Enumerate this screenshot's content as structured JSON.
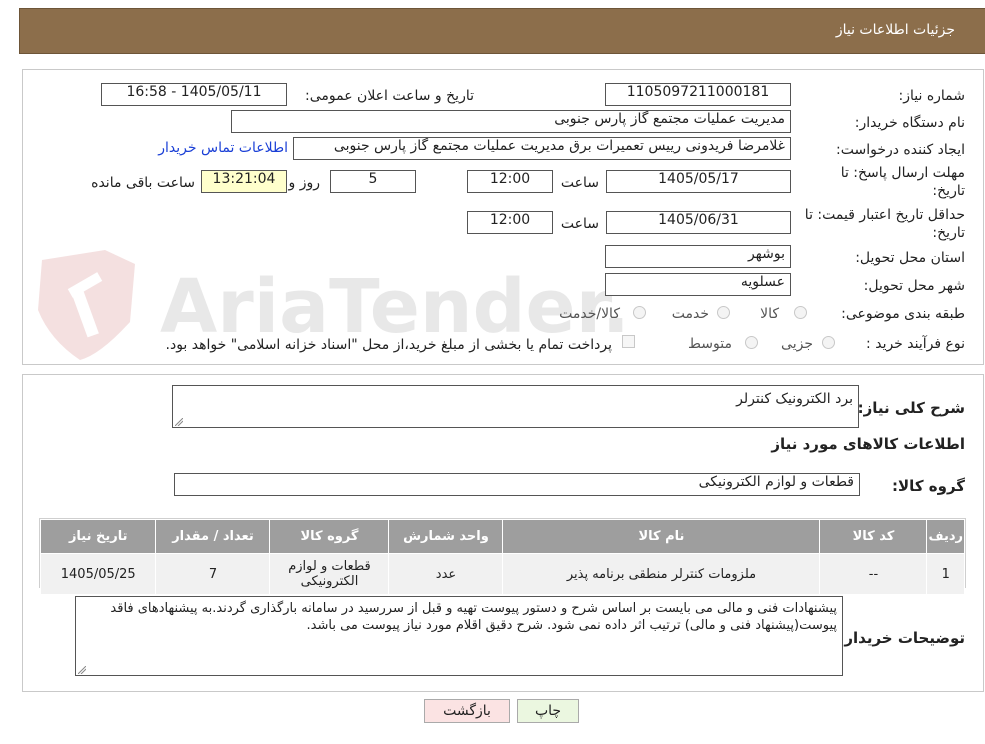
{
  "header": {
    "title": "جزئیات اطلاعات نیاز"
  },
  "watermark": {
    "text": "AriaTender.neT"
  },
  "form": {
    "need_number_label": "شماره نیاز:",
    "need_number": "1105097211000181",
    "announce_label": "تاریخ و ساعت اعلان عمومی:",
    "announce_value": "1405/05/11 - 16:58",
    "buyer_org_label": "نام دستگاه خریدار:",
    "buyer_org": "مدیریت عملیات مجتمع گاز پارس جنوبی",
    "requester_label": "ایجاد کننده درخواست:",
    "requester": "غلامرضا فریدونی رییس تعمیرات برق مدیریت عملیات مجتمع گاز پارس جنوبی",
    "contact_link": "اطلاعات تماس خریدار",
    "deadline_label_1": "مهلت ارسال پاسخ: تا",
    "deadline_label_2": "تاریخ:",
    "deadline_date": "1405/05/17",
    "time_label": "ساعت",
    "deadline_time": "12:00",
    "days_value": "5",
    "days_label": "روز و",
    "remaining_time": "13:21:04",
    "remaining_label": "ساعت باقی مانده",
    "validity_label_1": "حداقل تاریخ اعتبار قیمت: تا",
    "validity_label_2": "تاریخ:",
    "validity_date": "1405/06/31",
    "validity_time": "12:00",
    "province_label": "استان محل تحویل:",
    "province": "بوشهر",
    "city_label": "شهر محل تحویل:",
    "city": "عسلویه",
    "category_label": "طبقه بندی موضوعی:",
    "category_options": [
      "کالا",
      "خدمت",
      "کالا/خدمت"
    ],
    "process_label": "نوع فرآیند خرید :",
    "process_options": [
      "جزیی",
      "متوسط"
    ],
    "payment_note": "پرداخت تمام یا بخشی از مبلغ خرید،از محل \"اسناد خزانه اسلامی\" خواهد بود."
  },
  "details": {
    "summary_label": "شرح کلی نیاز:",
    "summary": "برد الکترونیک کنترلر",
    "goods_info_title": "اطلاعات کالاهای مورد نیاز",
    "group_label": "گروه کالا:",
    "group_value": "قطعات و لوازم الکترونیکی",
    "table": {
      "headers": [
        "ردیف",
        "کد کالا",
        "نام کالا",
        "واحد شمارش",
        "گروه کالا",
        "تعداد / مقدار",
        "تاریخ نیاز"
      ],
      "rows": [
        [
          "1",
          "--",
          "ملزومات کنترلر منطقی برنامه پذیر",
          "عدد",
          "قطعات و لوازم الکترونیکی",
          "7",
          "1405/05/25"
        ]
      ]
    },
    "buyer_notes_label": "توضیحات خریدار:",
    "buyer_notes": "پیشنهادات فنی و مالی می بایست بر اساس شرح و دستور پیوست تهیه و قبل از سررسید در سامانه بارگذاری گردند.به پیشنهادهای فاقد پیوست(پیشنهاد فنی و مالی) ترتیب اثر داده نمی شود. شرح دقیق اقلام مورد نیاز پیوست می باشد."
  },
  "buttons": {
    "print": "چاپ",
    "back": "بازگشت"
  },
  "colors": {
    "header_bg": "#8c6e4b",
    "table_header_bg": "#9e9e9e",
    "print_btn": "#ebf7e0",
    "back_btn": "#fbe3e3",
    "link": "#1a3fd6",
    "timer_bg": "#ffffcc"
  }
}
